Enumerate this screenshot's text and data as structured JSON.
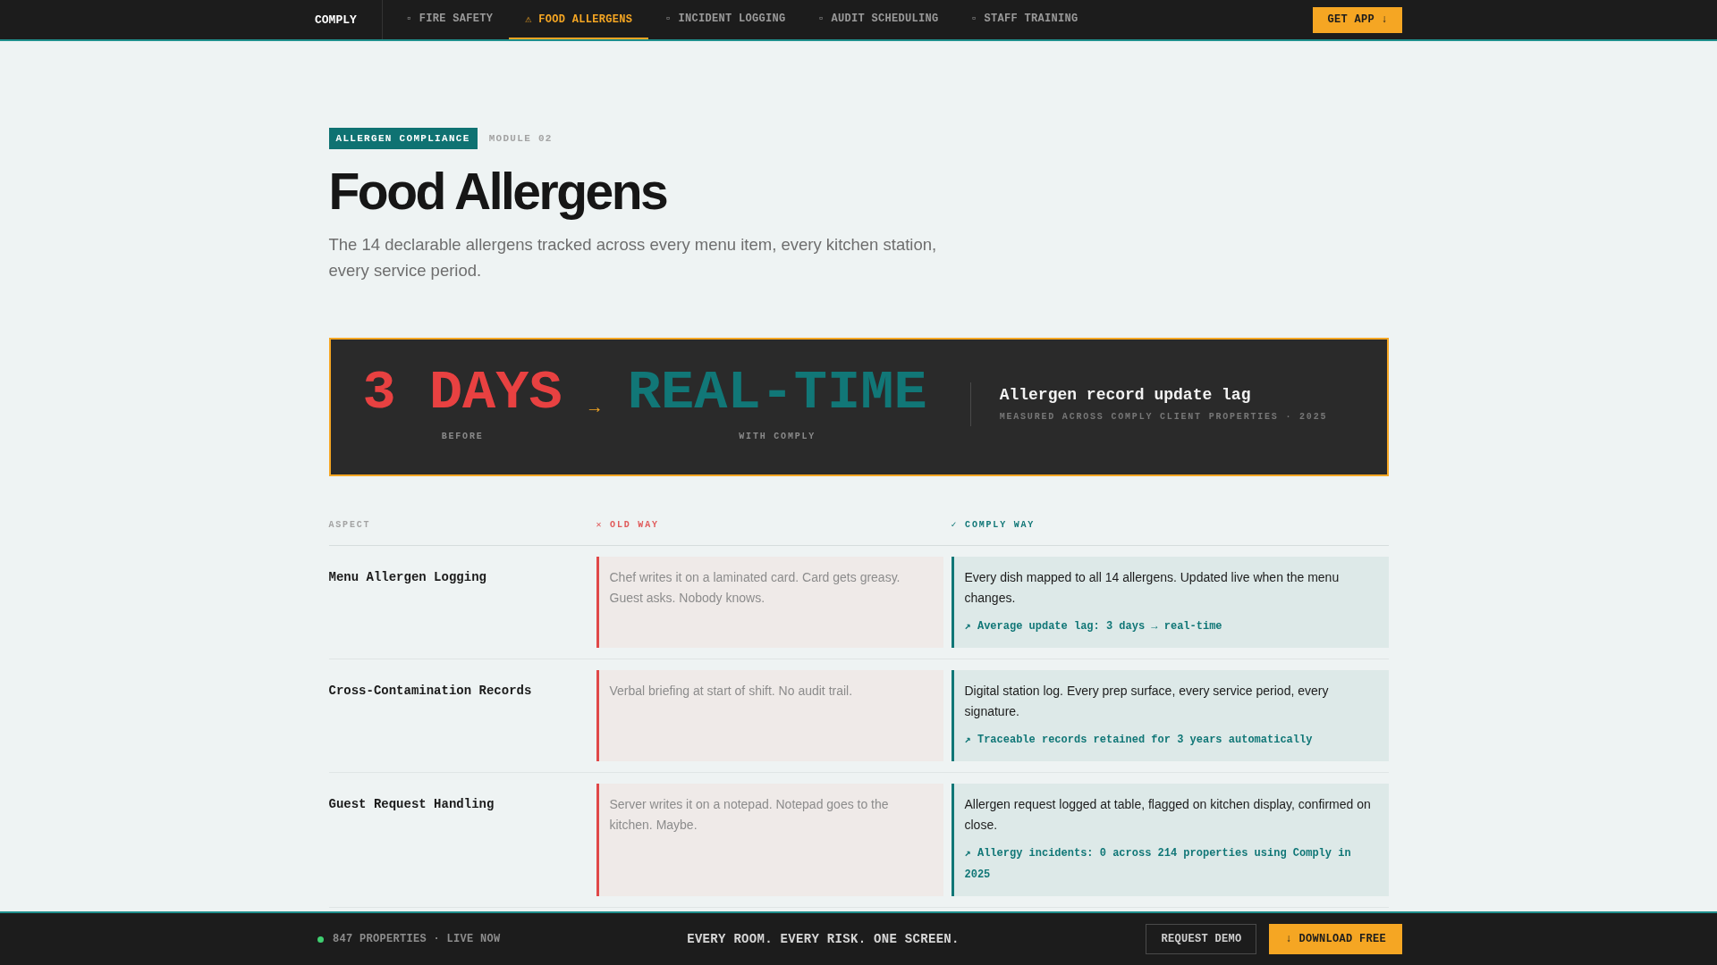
{
  "nav": {
    "logo": "COMPLY",
    "tabs": [
      {
        "label": "▫ FIRE SAFETY",
        "selected": false
      },
      {
        "label": "⚠ FOOD ALLERGENS",
        "selected": true
      },
      {
        "label": "▫ INCIDENT LOGGING",
        "selected": false
      },
      {
        "label": "▫ AUDIT SCHEDULING",
        "selected": false
      },
      {
        "label": "▫ STAFF TRAINING",
        "selected": false
      }
    ],
    "cta": "GET APP ↓"
  },
  "header": {
    "badge": "ALLERGEN COMPLIANCE",
    "module": "MODULE 02",
    "title": "Food Allergens",
    "subtitle": "The 14 declarable allergens tracked across every menu item, every kitchen station, every service period."
  },
  "banner": {
    "before": {
      "value": "3 DAYS",
      "label": "BEFORE"
    },
    "arrow": "→",
    "after": {
      "value": "REAL-TIME",
      "label": "WITH COMPLY"
    },
    "title": "Allergen record update lag",
    "note": "MEASURED ACROSS COMPLY CLIENT PROPERTIES · 2025"
  },
  "comparison": {
    "columns": [
      {
        "label": "ASPECT",
        "kind": "aspect"
      },
      {
        "label": "✕ OLD WAY",
        "kind": "old"
      },
      {
        "label": "✓ COMPLY WAY",
        "kind": "comply"
      }
    ],
    "rows": [
      {
        "aspect": "Menu Allergen Logging",
        "old_way": "Chef writes it on a laminated card. Card gets greasy. Guest asks. Nobody knows.",
        "comply_way": "Every dish mapped to all 14 allergens. Updated live when the menu changes.",
        "stat": "↗ Average update lag: 3 days → real-time"
      },
      {
        "aspect": "Cross-Contamination Records",
        "old_way": "Verbal briefing at start of shift. No audit trail.",
        "comply_way": "Digital station log. Every prep surface, every service period, every signature.",
        "stat": "↗ Traceable records retained for 3 years automatically"
      },
      {
        "aspect": "Guest Request Handling",
        "old_way": "Server writes it on a notepad. Notepad goes to the kitchen. Maybe.",
        "comply_way": "Allergen request logged at table, flagged on kitchen display, confirmed on close.",
        "stat": "↗ Allergy incidents: 0 across 214 properties using Comply in 2025"
      }
    ]
  },
  "footer": {
    "status": "847 PROPERTIES · LIVE NOW",
    "tagline": "EVERY ROOM. EVERY RISK. ONE SCREEN.",
    "buttons": [
      {
        "label": "REQUEST DEMO",
        "kind": "secondary"
      },
      {
        "label": "↓ DOWNLOAD FREE",
        "kind": "primary"
      }
    ]
  }
}
